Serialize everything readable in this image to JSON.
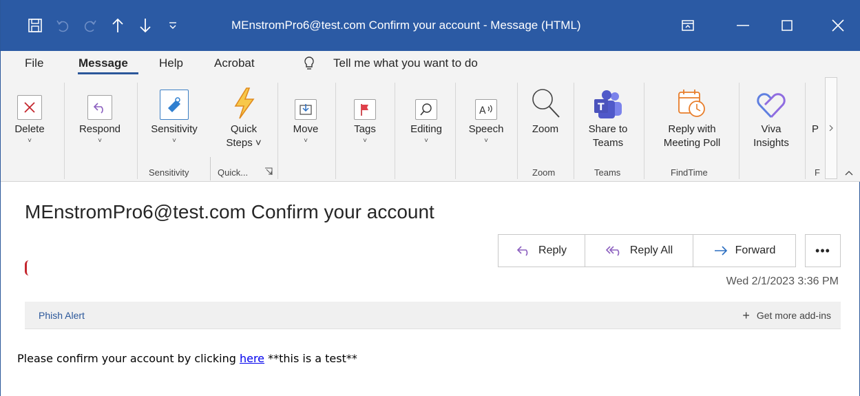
{
  "window": {
    "title": "MEnstromPro6@test.com Confirm your account  -  Message (HTML)"
  },
  "quick_access": [
    "save-icon",
    "undo-icon",
    "redo-icon",
    "up-arrow-icon",
    "down-arrow-icon",
    "customize-qat-icon"
  ],
  "menu": {
    "file": "File",
    "message": "Message",
    "help": "Help",
    "acrobat": "Acrobat",
    "tell_me": "Tell me what you want to do"
  },
  "ribbon": {
    "delete": {
      "l1": "Delete",
      "chev": "˅"
    },
    "respond": {
      "l1": "Respond",
      "chev": "˅"
    },
    "sensitivity": {
      "l1": "Sensitivity",
      "chev": "˅"
    },
    "quick_steps": {
      "l1": "Quick",
      "l2": "Steps ˅"
    },
    "move": {
      "l1": "Move",
      "chev": "˅"
    },
    "tags": {
      "l1": "Tags",
      "chev": "˅"
    },
    "editing": {
      "l1": "Editing",
      "chev": "˅"
    },
    "speech": {
      "l1": "Speech",
      "chev": "˅"
    },
    "zoom": {
      "l1": "Zoom"
    },
    "teams": {
      "l1": "Share to",
      "l2": "Teams"
    },
    "findtime": {
      "l1": "Reply with",
      "l2": "Meeting Poll"
    },
    "viva": {
      "l1": "Viva",
      "l2": "Insights"
    },
    "overflow": {
      "l1": "P"
    },
    "groups": {
      "sensitivity": "Sensitivity",
      "quick": "Quick...",
      "zoom": "Zoom",
      "teams": "Teams",
      "findtime": "FindTime",
      "overflow": "F"
    }
  },
  "message": {
    "subject": "MEnstromPro6@test.com Confirm your account",
    "reply": "Reply",
    "reply_all": "Reply All",
    "forward": "Forward",
    "more": "•••",
    "datetime": "Wed 2/1/2023 3:36 PM",
    "phish_alert": "Phish Alert",
    "get_addins": "Get more add-ins",
    "body_before": "Please confirm your account by clicking ",
    "body_link": "here",
    "body_after": " **this is a test**"
  },
  "colors": {
    "titlebar": "#2b5aa4",
    "accent": "#2b579a",
    "delete_red": "#c4262e",
    "respond_purple": "#8b5fbf"
  }
}
